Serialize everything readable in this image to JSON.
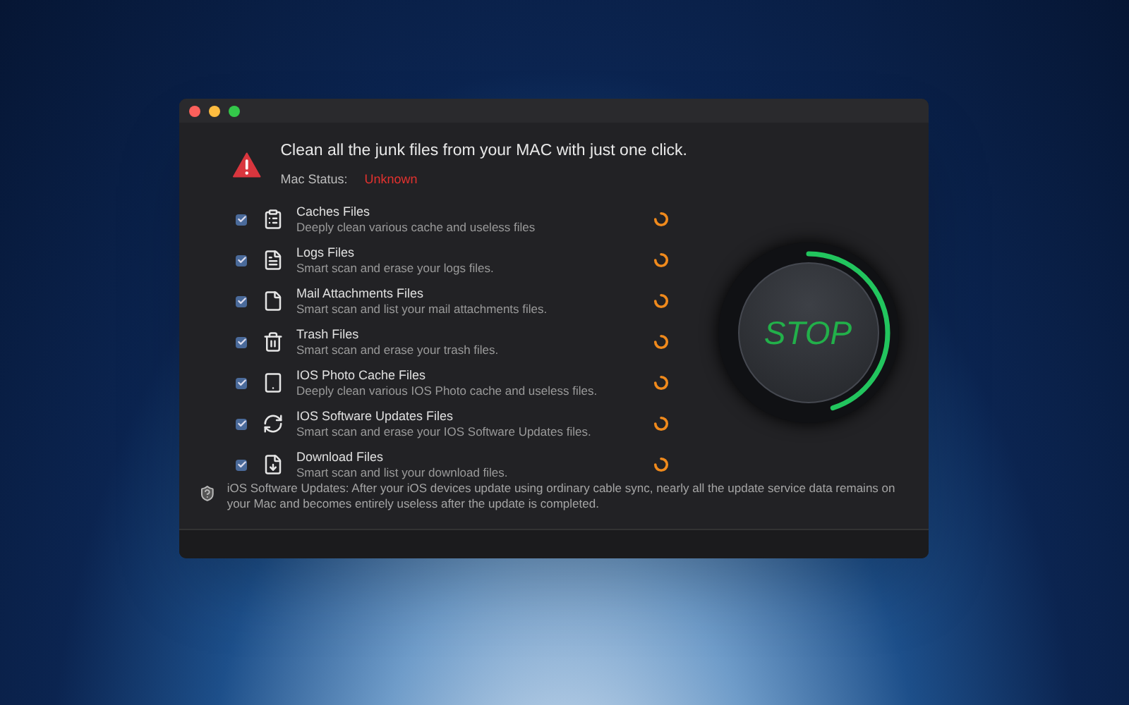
{
  "header": {
    "headline": "Clean all the junk files from your MAC with just one click.",
    "status_label": "Mac Status:",
    "status_value": "Unknown"
  },
  "items": [
    {
      "title": "Caches Files",
      "description": "Deeply clean various cache and useless files",
      "checked": true
    },
    {
      "title": "Logs Files",
      "description": "Smart scan and erase your logs files.",
      "checked": true
    },
    {
      "title": "Mail Attachments Files",
      "description": "Smart scan and list your mail attachments files.",
      "checked": true
    },
    {
      "title": "Trash Files",
      "description": "Smart scan and erase your trash files.",
      "checked": true
    },
    {
      "title": "IOS Photo Cache Files",
      "description": "Deeply clean various IOS Photo cache and useless files.",
      "checked": true
    },
    {
      "title": "IOS Software Updates Files",
      "description": "Smart scan and erase your IOS Software Updates files.",
      "checked": true
    },
    {
      "title": "Download Files",
      "description": "Smart scan and list your download files.",
      "checked": true
    }
  ],
  "note": "iOS Software Updates: After your iOS devices update using ordinary cable sync, nearly all the update service data remains on your Mac and becomes entirely useless after the update is completed.",
  "stop_button": {
    "label": "STOP",
    "level": 0.45
  }
}
